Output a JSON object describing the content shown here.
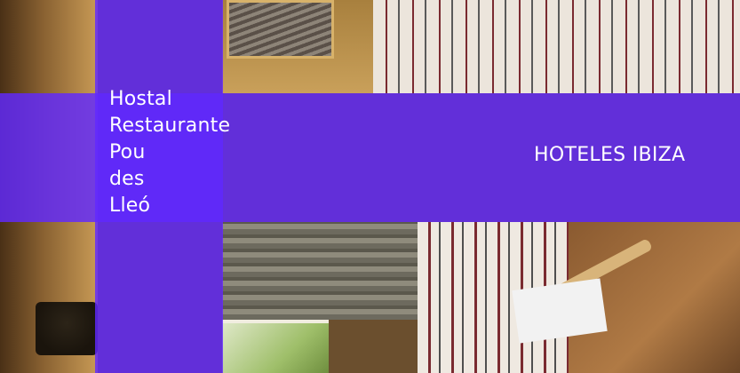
{
  "hero": {
    "title_lines": [
      "Hostal",
      "Restaurante",
      "Pou",
      "des",
      "Lleó"
    ],
    "category_label": "HOTELES IBIZA"
  },
  "colors": {
    "overlay": "#6028ff",
    "text": "#ffffff"
  }
}
